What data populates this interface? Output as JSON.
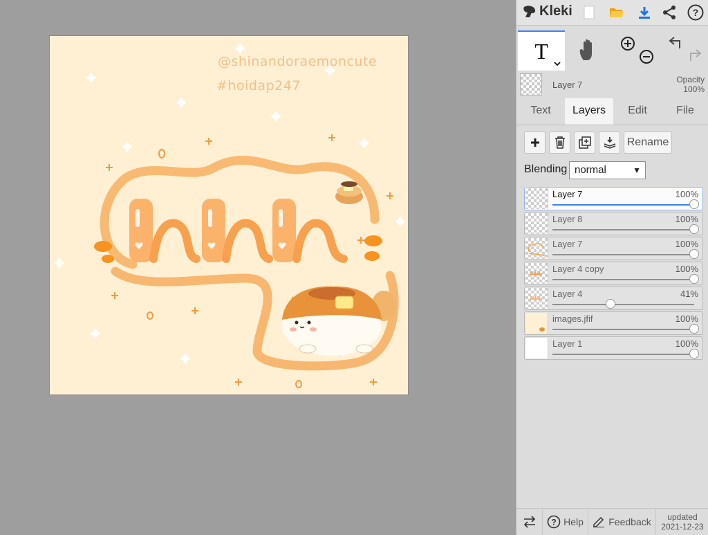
{
  "app": {
    "name": "Kleki"
  },
  "canvas": {
    "handle_line1": "@shinandoraemoncute",
    "handle_line2": "#hoidap247",
    "colors": {
      "background": "#fff0d4",
      "accent": "#f7a14e",
      "dark_accent": "#e8812a"
    }
  },
  "topbar": {
    "icons": [
      "new-file-icon",
      "open-folder-icon",
      "download-icon",
      "share-icon",
      "help-icon"
    ]
  },
  "tools": {
    "active": "text",
    "items": [
      "text-tool-icon",
      "hand-tool-icon",
      "zoom-in-icon",
      "zoom-out-icon",
      "undo-icon",
      "redo-icon"
    ]
  },
  "current_layer": {
    "name": "Layer 7",
    "opacity_label": "Opacity",
    "opacity_value": "100%"
  },
  "tabs": [
    {
      "label": "Text"
    },
    {
      "label": "Layers",
      "active": true
    },
    {
      "label": "Edit"
    },
    {
      "label": "File"
    }
  ],
  "layer_buttons": {
    "rename": "Rename"
  },
  "blending": {
    "label": "Blending",
    "value": "normal"
  },
  "layers": [
    {
      "name": "Layer 7",
      "opacity": "100%",
      "level": 1.0,
      "active": true
    },
    {
      "name": "Layer 8",
      "opacity": "100%",
      "level": 1.0
    },
    {
      "name": "Layer 7",
      "opacity": "100%",
      "level": 1.0
    },
    {
      "name": "Layer 4 copy",
      "opacity": "100%",
      "level": 1.0
    },
    {
      "name": "Layer 4",
      "opacity": "41%",
      "level": 0.41
    },
    {
      "name": "images.jfif",
      "opacity": "100%",
      "level": 1.0
    },
    {
      "name": "Layer 1",
      "opacity": "100%",
      "level": 1.0
    }
  ],
  "footer": {
    "help": "Help",
    "feedback": "Feedback",
    "updated_label": "updated",
    "updated_date": "2021-12-23"
  }
}
